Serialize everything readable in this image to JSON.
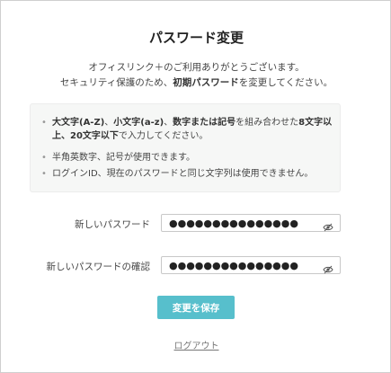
{
  "page": {
    "title": "パスワード変更",
    "intro_line1": "オフィスリンク＋のご利用ありがとうございます。",
    "intro_line2_before": "セキュリティ保護のため、",
    "intro_line2_bold": "初期パスワード",
    "intro_line2_after": "を変更してください。"
  },
  "rules": [
    {
      "parts": [
        {
          "bold": true,
          "text": "大文字(A-Z)"
        },
        {
          "bold": false,
          "text": "、"
        },
        {
          "bold": true,
          "text": "小文字(a-z)"
        },
        {
          "bold": false,
          "text": "、"
        },
        {
          "bold": true,
          "text": "数字または記号"
        },
        {
          "bold": false,
          "text": "を組み合わせた"
        },
        {
          "bold": true,
          "text": "8文字以上、20文字以下"
        },
        {
          "bold": false,
          "text": "で入力してください。"
        }
      ]
    },
    {
      "parts": [
        {
          "bold": false,
          "text": "半角英数字、記号が使用できます。"
        }
      ]
    },
    {
      "parts": [
        {
          "bold": false,
          "text": "ログインID、現在のパスワードと同じ文字列は使用できません。"
        }
      ]
    }
  ],
  "form": {
    "new_password_label": "新しいパスワード",
    "new_password_value": "●●●●●●●●●●●●●●●",
    "confirm_password_label": "新しいパスワードの確認",
    "confirm_password_value": "●●●●●●●●●●●●●●●",
    "toggle_icon": "eye-slash-icon",
    "save_label": "変更を保存",
    "logout_label": "ログアウト"
  },
  "colors": {
    "accent": "#57bfcc",
    "panel_bg": "#f6f7f6"
  }
}
